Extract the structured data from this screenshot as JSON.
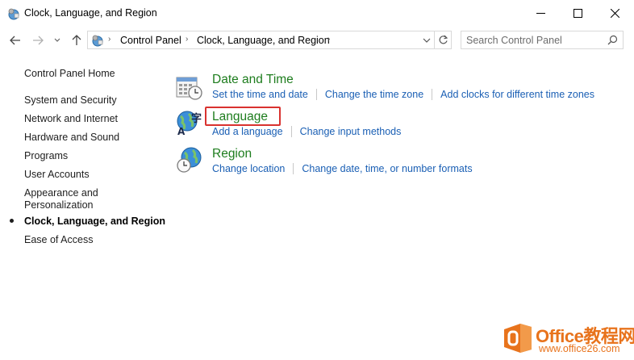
{
  "window": {
    "title": "Clock, Language, and Region",
    "controls": [
      "minimize-icon",
      "maximize-icon",
      "close-icon"
    ]
  },
  "address_bar": {
    "breadcrumbs": [
      "Control Panel",
      "Clock, Language, and Region"
    ]
  },
  "search": {
    "placeholder": "Search Control Panel"
  },
  "sidebar": {
    "home": "Control Panel Home",
    "items": [
      {
        "label": "System and Security"
      },
      {
        "label": "Network and Internet"
      },
      {
        "label": "Hardware and Sound"
      },
      {
        "label": "Programs"
      },
      {
        "label": "User Accounts"
      },
      {
        "label": "Appearance and"
      },
      {
        "label": "Personalization"
      },
      {
        "label": "Clock, Language, and Region",
        "active": true
      },
      {
        "label": "Ease of Access"
      }
    ]
  },
  "categories": [
    {
      "title": "Date and Time",
      "icon": "calendar-clock-icon",
      "links": [
        "Set the time and date",
        "Change the time zone",
        "Add clocks for different time zones"
      ]
    },
    {
      "title": "Language",
      "icon": "language-globe-icon",
      "links": [
        "Add a language",
        "Change input methods"
      ]
    },
    {
      "title": "Region",
      "icon": "region-globe-clock-icon",
      "links": [
        "Change location",
        "Change date, time, or number formats"
      ]
    }
  ],
  "watermark": {
    "line1": "Office教程网",
    "line2": "www.office26.com"
  },
  "colors": {
    "category_title": "#1e7d1e",
    "link": "#1a5fb4",
    "highlight_box": "#d9322f",
    "watermark": "#e8731c"
  }
}
